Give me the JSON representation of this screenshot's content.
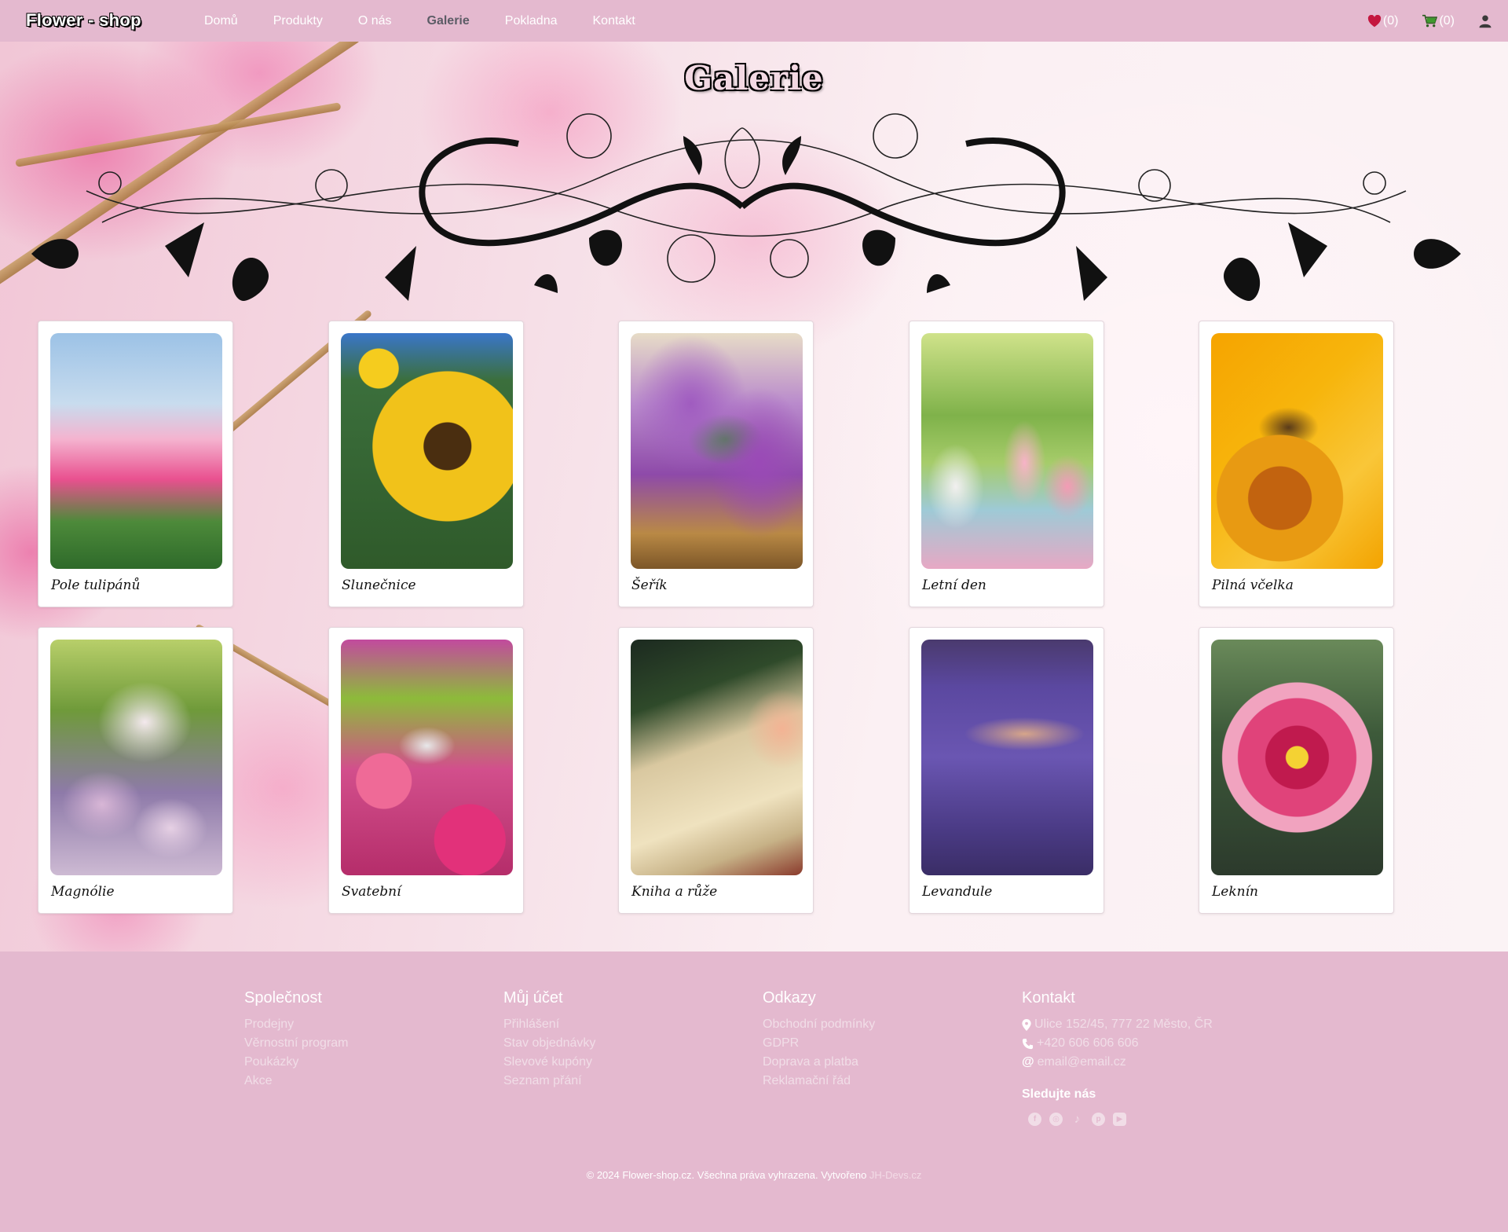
{
  "nav": {
    "brand": "Flower - shop",
    "links": [
      "Domů",
      "Produkty",
      "O nás",
      "Galerie",
      "Pokladna",
      "Kontakt"
    ],
    "active": "Galerie",
    "wishlist_count": "(0)",
    "cart_count": "(0)",
    "icons": {
      "wishlist": "heart-icon",
      "cart": "cart-icon",
      "account": "user-icon"
    }
  },
  "gallery": {
    "title": "Galerie",
    "items": [
      {
        "caption": "Pole tulipánů"
      },
      {
        "caption": "Slunečnice"
      },
      {
        "caption": "Šeřík"
      },
      {
        "caption": "Letní den"
      },
      {
        "caption": "Pilná včelka"
      },
      {
        "caption": "Magnólie"
      },
      {
        "caption": "Svatební"
      },
      {
        "caption": "Kniha a růže"
      },
      {
        "caption": "Levandule"
      },
      {
        "caption": "Leknín"
      }
    ]
  },
  "footer": {
    "company": {
      "heading": "Společnost",
      "links": [
        "Prodejny",
        "Věrnostní program",
        "Poukázky",
        "Akce"
      ]
    },
    "account": {
      "heading": "Můj účet",
      "links": [
        "Přihlášení",
        "Stav objednávky",
        "Slevové kupóny",
        "Seznam přání"
      ]
    },
    "links": {
      "heading": "Odkazy",
      "links": [
        "Obchodní podmínky",
        "GDPR",
        "Doprava a platba",
        "Reklamační řád"
      ]
    },
    "contact": {
      "heading": "Kontakt",
      "address": "Ulice 152/45, 777 22 Město, ČR",
      "phone": "+420 606 606 606",
      "email": "email@email.cz",
      "follow": "Sledujte nás",
      "socials": [
        "facebook-icon",
        "instagram-icon",
        "tiktok-icon",
        "pinterest-icon",
        "youtube-icon"
      ]
    },
    "copyright": "© 2024 Flower-shop.cz. Všechna práva vyhrazena. Vytvořeno",
    "developer": "JH-Devs.cz"
  },
  "colors": {
    "brand_pink": "#e4b9cf",
    "heart": "#c4173f",
    "cart": "#3f9a2d"
  }
}
